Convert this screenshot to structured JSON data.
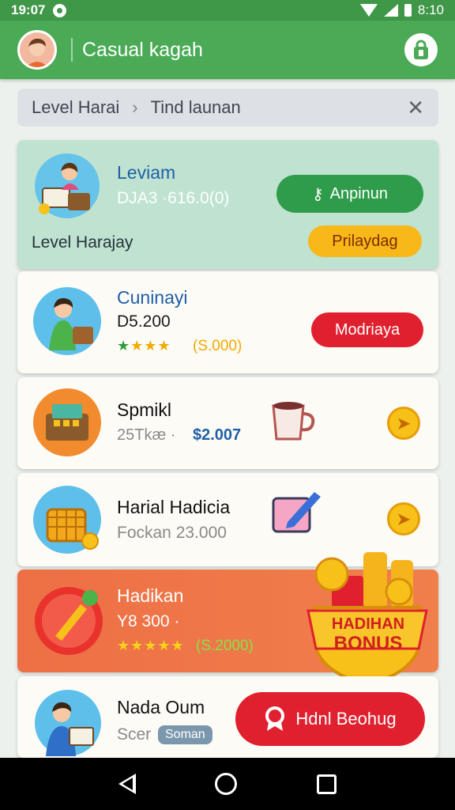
{
  "status": {
    "time": "19:07",
    "clock_right": "8:10"
  },
  "appbar": {
    "title": "Casual kagah"
  },
  "search": {
    "crumb": "Level Harai",
    "query": "Tind launan"
  },
  "cards": [
    {
      "name": "Leviam",
      "sub": "DJA3 ·616.0(0)",
      "button": "Anpinun",
      "tag_label": "Level Harajay",
      "button2": "Prilaydag"
    },
    {
      "name": "Cuninayi",
      "price": "D5.200",
      "rating_value": "(S.000)",
      "button": "Modriaya"
    },
    {
      "name": "Spmikl",
      "price": "25Tkæ ·",
      "amount": "$2.007"
    },
    {
      "name": "Harial Hadicia",
      "price": "Fockan 23.000"
    },
    {
      "name": "Hadikan",
      "price": "Y8 300 ·",
      "rating_value": "(S.2000)"
    },
    {
      "name": "Nada Oum",
      "sub": "Scer",
      "badge": "Soman",
      "button": "Hdnl Beohug"
    }
  ],
  "bonus": {
    "line1": "HADIHAN",
    "line2": "BONUS"
  },
  "colors": {
    "green": "#4aaa55",
    "red": "#e0202e",
    "orange": "#ee6f45",
    "gold": "#f7c11a",
    "blue": "#1f5fa8"
  }
}
